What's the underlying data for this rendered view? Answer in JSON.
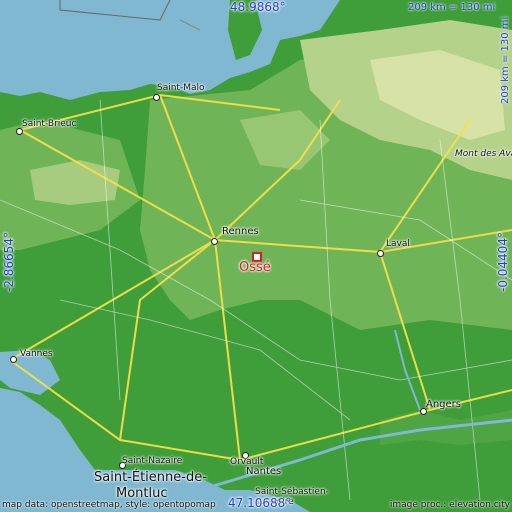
{
  "map": {
    "place": "Ossé",
    "coords": {
      "top_lat": "48.9868°",
      "bottom_lat": "47.10688°",
      "left_lon": "-2.86654°",
      "right_lon": "-0.04404°"
    },
    "scale": {
      "top": "209 km = 130 mi",
      "right": "209 km = 130 mi"
    },
    "cities": {
      "saint_malo": "Saint-Malo",
      "saint_brieuc": "Saint-Brieuc",
      "rennes": "Rennes",
      "laval": "Laval",
      "mont_des_avaloirs": "Mont des Ava",
      "vannes": "Vannes",
      "angers": "Angers",
      "saint_nazaire": "Saint-Nazaire",
      "saint_etienne_1": "Saint-Étienne-de-",
      "saint_etienne_2": "Montluc",
      "orvault": "Orvault",
      "nantes": "Nantes",
      "saint_sebastien": "Saint-Sébastien-",
      "saint_sebastien_2": "sur-Loire"
    },
    "attribution": {
      "left": "map data: openstreetmap, style: opentopomap",
      "right": "image proc.: elevation.city"
    },
    "colors": {
      "sea": "#7fb8d0",
      "lowland": "#3f9e3a",
      "land": "#8cc46a",
      "highland": "#c9dc9a",
      "road": "#f4e04a",
      "coord_text": "#1f3fd6",
      "place_marker": "#d81d2a"
    }
  }
}
